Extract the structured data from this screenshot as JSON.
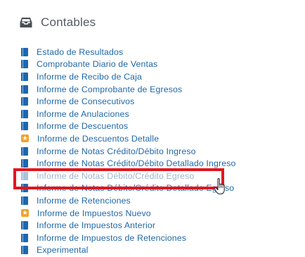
{
  "section": {
    "title": "Contables",
    "icon": "inbox-icon"
  },
  "reports": [
    {
      "label": "Estado de Resultados",
      "icon": "book-icon"
    },
    {
      "label": "Comprobante Diario de Ventas",
      "icon": "book-icon"
    },
    {
      "label": "Informe de Recibo de Caja",
      "icon": "book-icon"
    },
    {
      "label": "Informe de Comprobante de Egresos",
      "icon": "book-icon"
    },
    {
      "label": "Informe de Consecutivos",
      "icon": "book-icon"
    },
    {
      "label": "Informe de Anulaciones",
      "icon": "book-icon"
    },
    {
      "label": "Informe de Descuentos",
      "icon": "book-icon"
    },
    {
      "label": "Informe de Descuentos Detalle",
      "icon": "star-icon"
    },
    {
      "label": "Informe de Notas Crédito/Débito Ingreso",
      "icon": "book-icon"
    },
    {
      "label": "Informe de Notas Crédito/Débito Detallado Ingreso",
      "icon": "book-icon"
    },
    {
      "label": "Informe de Notas Débito/Crédito Egreso",
      "icon": "book-icon",
      "highlighted": true
    },
    {
      "label": "Informe de Notas Débito/Crédito Detallado Egreso",
      "icon": "book-icon"
    },
    {
      "label": "Informe de Retenciones",
      "icon": "book-icon"
    },
    {
      "label": "Informe de Impuestos Nuevo",
      "icon": "star-icon"
    },
    {
      "label": "Informe de Impuestos Anterior",
      "icon": "book-icon"
    },
    {
      "label": "Informe de Impuestos de Retenciones",
      "icon": "book-icon"
    },
    {
      "label": "Experimental",
      "icon": "book-icon"
    }
  ],
  "colors": {
    "link": "#1f67a8",
    "highlight": "#e0161e",
    "star": "#f2a32c",
    "book": "#1c68b0"
  }
}
